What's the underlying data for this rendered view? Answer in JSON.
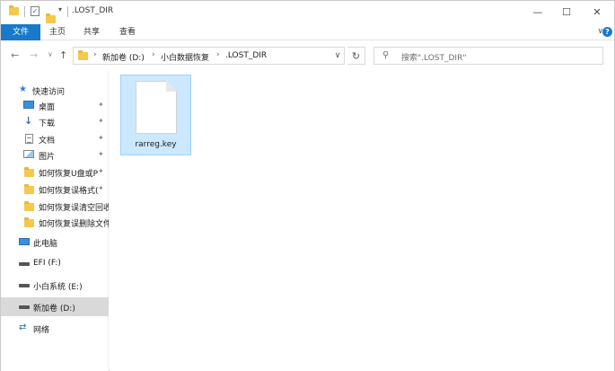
{
  "titlebar": {
    "title": ".LOST_DIR",
    "minimize": "—",
    "maximize": "☐",
    "close": "✕"
  },
  "ribbon": {
    "tabs": [
      "文件",
      "主页",
      "共享",
      "查看"
    ],
    "expand": "∨",
    "help": "?"
  },
  "nav": {
    "back": "←",
    "forward": "→",
    "dropdown": "∨",
    "up": "↑",
    "breadcrumb": [
      "新加卷 (D:)",
      "小白数据恢复",
      ".LOST_DIR"
    ],
    "crumb_sep": "›",
    "address_dropdown": "∨",
    "refresh": "↻"
  },
  "search": {
    "placeholder": "搜索\".LOST_DIR\""
  },
  "sidebar": {
    "quick_access": "快速访问",
    "items": [
      {
        "label": "桌面",
        "icon": "desktop-icon",
        "pinned": true
      },
      {
        "label": "下载",
        "icon": "download-icon",
        "pinned": true
      },
      {
        "label": "文档",
        "icon": "document-icon",
        "pinned": true
      },
      {
        "label": "图片",
        "icon": "picture-icon",
        "pinned": true
      },
      {
        "label": "如何恢复U盘或P",
        "icon": "folder-icon",
        "pinned": true
      },
      {
        "label": "如何恢复误格式(",
        "icon": "folder-icon",
        "pinned": true
      },
      {
        "label": "如何恢复误清空回收",
        "icon": "folder-icon",
        "pinned": false
      },
      {
        "label": "如何恢复误删除文件",
        "icon": "folder-icon",
        "pinned": false
      }
    ],
    "this_pc": "此电脑",
    "drives": [
      {
        "label": "EFI (F:)",
        "selected": false
      },
      {
        "label": "小白系统 (E:)",
        "selected": false
      },
      {
        "label": "新加卷 (D:)",
        "selected": true
      }
    ],
    "network": "网络",
    "pin_glyph": "✦"
  },
  "content": {
    "files": [
      {
        "name": "rarreg.key",
        "selected": true
      }
    ]
  },
  "colors": {
    "accent": "#1979ca",
    "selection_bg": "#cce8ff",
    "selection_border": "#99d1ff",
    "folder": "#f6c94c"
  }
}
